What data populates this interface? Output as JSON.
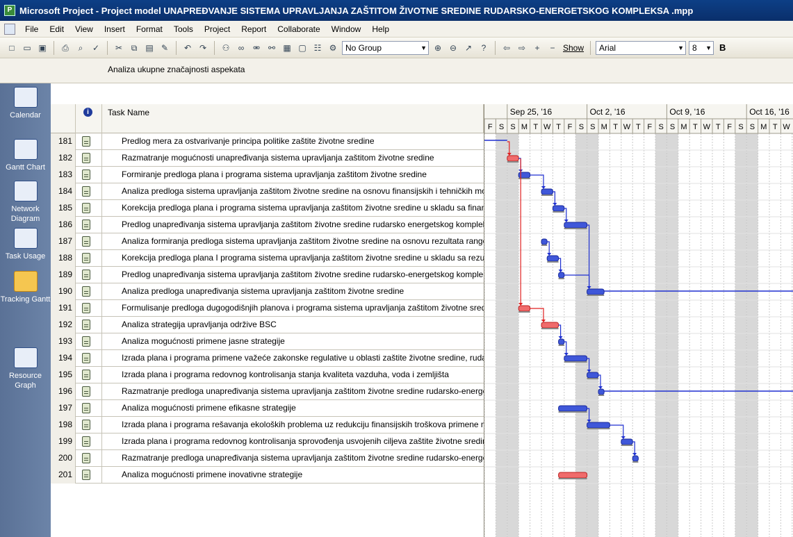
{
  "window": {
    "title": "Microsoft Project - Project model UNAPREĐVANJE SISTEMA UPRAVLJANJA ZAŠTITOM ŽIVOTNE SREDINE RUDARSKO-ENERGETSKOG KOMPLEKSA .mpp"
  },
  "menu": [
    "File",
    "Edit",
    "View",
    "Insert",
    "Format",
    "Tools",
    "Project",
    "Report",
    "Collaborate",
    "Window",
    "Help"
  ],
  "toolbar": {
    "group_combo": "No Group",
    "show_label": "Show",
    "font_combo": "Arial",
    "size_combo": "8",
    "bold_label": "B"
  },
  "entry_bar": {
    "value": "Analiza ukupne značajnosti aspekata"
  },
  "view_bar": [
    {
      "label": "Calendar",
      "icon": "calendar-icon"
    },
    {
      "label": "Gantt Chart",
      "icon": "gantt-chart-icon"
    },
    {
      "label": "Network Diagram",
      "icon": "network-diagram-icon"
    },
    {
      "label": "Task Usage",
      "icon": "task-usage-icon"
    },
    {
      "label": "Tracking Gantt",
      "icon": "tracking-gantt-icon",
      "active": true
    },
    {
      "label": "Resource Graph",
      "icon": "resource-graph-icon"
    }
  ],
  "table": {
    "header": {
      "task_name": "Task Name",
      "info_icon": "info-icon"
    },
    "rows": [
      {
        "id": "181",
        "name": "Predlog mera za ostvarivanje principa politike zaštite životne sredine"
      },
      {
        "id": "182",
        "name": "Razmatranje mogućnosti unapređivanja sistema upravljanja zaštitom životne sredine"
      },
      {
        "id": "183",
        "name": "Formiranje predloga plana i programa sistema upravljanja zaštitom životne sredine"
      },
      {
        "id": "184",
        "name": "Analiza predloga sistema upravljanja zaštitom životne sredine na osnovu finansijskih i tehničkih mogućnosti"
      },
      {
        "id": "185",
        "name": "Korekcija predloga plana i programa sistema upravljanja zaštitom životne sredine u skladu sa finansijskim"
      },
      {
        "id": "186",
        "name": "Predlog unapređivanja sistema upravljanja zaštitom životne sredine rudarsko energetskog kompleksa za r"
      },
      {
        "id": "187",
        "name": "Analiza formiranja predloga sistema upravljanja zaštitom životne sredine na osnovu rezultata rangova tež"
      },
      {
        "id": "188",
        "name": "Korekcija predloga plana I programa sistema upravljanja zaštitom životne sredine u skladu sa rezultatima a"
      },
      {
        "id": "189",
        "name": "Predlog unapređivanja sistema upravljanja zaštitom životne sredine rudarsko-energetskog kompleksa za r"
      },
      {
        "id": "190",
        "name": "Analiza predloga unapređivanja sistema upravljanja zaštitom životne sredine"
      },
      {
        "id": "191",
        "name": "Formulisanje predloga dugogodišnjih planova i programa sistema upravljanja zaštitom životne sredine ruda"
      },
      {
        "id": "192",
        "name": "Analiza strategija upravljanja održive BSC"
      },
      {
        "id": "193",
        "name": "Analiza mogućnosti primene jasne strategije"
      },
      {
        "id": "194",
        "name": "Izrada plana i programa primene važeće zakonske regulative u oblasti zaštite životne sredine, rudarstva i"
      },
      {
        "id": "195",
        "name": "Izrada plana i programa redovnog kontrolisanja stanja kvaliteta vazduha, voda i zemljišta"
      },
      {
        "id": "196",
        "name": "Razmatranje predloga unapređivanja sistema upravljanja zaštitom životne sredine rudarsko-energetskog k"
      },
      {
        "id": "197",
        "name": "Analiza mogućnosti primene efikasne strategije"
      },
      {
        "id": "198",
        "name": "Izrada plana i programa rešavanja ekoloških problema uz redukciju finansijskih troškova primene mera za"
      },
      {
        "id": "199",
        "name": "Izrada plana i programa redovnog kontrolisanja sprovođenja usvojenih ciljeva zaštite životne sredine"
      },
      {
        "id": "200",
        "name": "Razmatranje predloga unapređivanja sistema upravljanja zaštitom životne sredine rudarsko-energetskog k"
      },
      {
        "id": "201",
        "name": "Analiza mogućnosti primene inovativne strategije"
      }
    ]
  },
  "timescale": {
    "weeks": [
      "Sep 25, '16",
      "Oct 2, '16",
      "Oct 9, '16",
      "Oct 16, '16"
    ],
    "days": [
      "F",
      "S",
      "S",
      "M",
      "T",
      "W",
      "T",
      "F",
      "S",
      "S",
      "M",
      "T",
      "W",
      "T",
      "F",
      "S",
      "S",
      "M",
      "T",
      "W",
      "T",
      "F",
      "S",
      "S",
      "M",
      "T",
      "W"
    ]
  },
  "bars": [
    {
      "row": "181",
      "start_day": 0,
      "duration_days": 2.0,
      "critical": false,
      "summary_line": true
    },
    {
      "row": "182",
      "start_day": 2.0,
      "duration_days": 1.0,
      "critical": true
    },
    {
      "row": "183",
      "start_day": 3.0,
      "duration_days": 1.0,
      "critical": false
    },
    {
      "row": "184",
      "start_day": 5.0,
      "duration_days": 1.0,
      "critical": false
    },
    {
      "row": "185",
      "start_day": 6.0,
      "duration_days": 1.0,
      "critical": false
    },
    {
      "row": "186",
      "start_day": 7.0,
      "duration_days": 2.0,
      "critical": false
    },
    {
      "row": "187",
      "start_day": 5.0,
      "duration_days": 0.5,
      "critical": false
    },
    {
      "row": "188",
      "start_day": 5.5,
      "duration_days": 1.0,
      "critical": false
    },
    {
      "row": "189",
      "start_day": 6.5,
      "duration_days": 0.5,
      "critical": false
    },
    {
      "row": "190",
      "start_day": 9.0,
      "duration_days": 1.5,
      "critical": false,
      "trailing_line": true
    },
    {
      "row": "191",
      "start_day": 3.0,
      "duration_days": 1.0,
      "critical": true
    },
    {
      "row": "192",
      "start_day": 5.0,
      "duration_days": 1.5,
      "critical": true
    },
    {
      "row": "193",
      "start_day": 6.5,
      "duration_days": 0.5,
      "critical": false
    },
    {
      "row": "194",
      "start_day": 7.0,
      "duration_days": 2.0,
      "critical": false
    },
    {
      "row": "195",
      "start_day": 9.0,
      "duration_days": 1.0,
      "critical": false
    },
    {
      "row": "196",
      "start_day": 10.0,
      "duration_days": 0.5,
      "critical": false,
      "trailing_line": true
    },
    {
      "row": "197",
      "start_day": 6.5,
      "duration_days": 2.5,
      "critical": false
    },
    {
      "row": "198",
      "start_day": 9.0,
      "duration_days": 2.0,
      "critical": false
    },
    {
      "row": "199",
      "start_day": 12.0,
      "duration_days": 1.0,
      "critical": false
    },
    {
      "row": "200",
      "start_day": 13.0,
      "duration_days": 0.5,
      "critical": false
    },
    {
      "row": "201",
      "start_day": 6.5,
      "duration_days": 2.5,
      "critical": true
    }
  ],
  "colors": {
    "title_bar": "#0d3f86",
    "normal_bar": "#3f57d9",
    "critical_bar": "#f06b6b",
    "critical_link": "#e02020",
    "normal_link": "#1e2fd0",
    "nonworking_shade": "#d8d8d8"
  }
}
